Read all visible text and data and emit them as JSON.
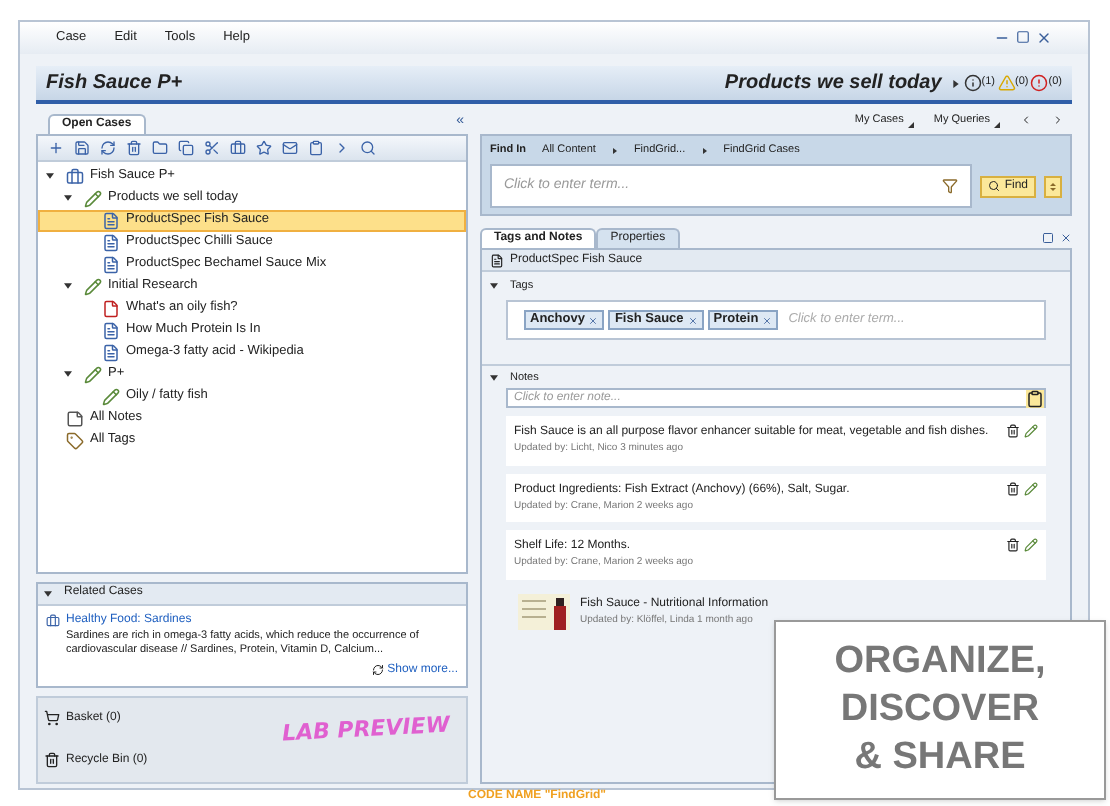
{
  "menu": [
    "Case",
    "Edit",
    "Tools",
    "Help"
  ],
  "title": "Fish Sauce P+",
  "context_title": "Products we sell today",
  "status_counts": [
    {
      "kind": "info",
      "count": "(1)"
    },
    {
      "kind": "warning",
      "count": "(0)"
    },
    {
      "kind": "error",
      "count": "(0)"
    }
  ],
  "left_tab": "Open Cases",
  "collapse_glyph": "«",
  "tree": [
    {
      "label": "Fish Sauce P+",
      "kind": "case",
      "expanded": true,
      "selected": false,
      "children": [
        {
          "label": "Products we sell today",
          "kind": "folder",
          "expanded": true,
          "selected": false,
          "children": [
            {
              "label": "ProductSpec Fish Sauce",
              "kind": "doc",
              "selected": true
            },
            {
              "label": "ProductSpec Chilli Sauce",
              "kind": "doc",
              "selected": false
            },
            {
              "label": "ProductSpec Bechamel Sauce Mix",
              "kind": "doc",
              "selected": false
            }
          ]
        },
        {
          "label": "Initial Research",
          "kind": "folder",
          "expanded": true,
          "selected": false,
          "children": [
            {
              "label": "What's an oily fish?",
              "kind": "pdf",
              "selected": false
            },
            {
              "label": "How Much Protein Is In",
              "kind": "doc",
              "selected": false
            },
            {
              "label": "Omega-3 fatty acid - Wikipedia",
              "kind": "doc",
              "selected": false
            }
          ]
        },
        {
          "label": "P+",
          "kind": "folder",
          "expanded": true,
          "selected": false,
          "children": [
            {
              "label": "Oily / fatty fish",
              "kind": "folder",
              "selected": false
            }
          ]
        }
      ]
    },
    {
      "label": "All Notes",
      "kind": "note",
      "selected": false
    },
    {
      "label": "All Tags",
      "kind": "tag",
      "selected": false
    }
  ],
  "related_cases": {
    "title": "Related Cases",
    "expanded": true,
    "link": "Healthy Food: Sardines",
    "text": "Sardines are rich in omega-3 fatty acids, which reduce the occurrence of cardiovascular disease // Sardines, Protein, Vitamin D, Calcium...",
    "more": "Show more..."
  },
  "bins": [
    {
      "kind": "basket",
      "label": "Basket (0)"
    },
    {
      "kind": "trash",
      "label": "Recycle Bin (0)"
    }
  ],
  "lab_preview": "LAB PREVIEW",
  "top_links": [
    "My Cases",
    "My Queries"
  ],
  "find": {
    "label": "Find In",
    "path": [
      "All Content",
      "FindGrid...",
      "FindGrid Cases"
    ],
    "placeholder": "Click to enter term...",
    "button": "Find"
  },
  "detail_tabs": [
    {
      "label": "Tags and Notes",
      "selected": true
    },
    {
      "label": "Properties",
      "selected": false
    }
  ],
  "document": "ProductSpec Fish Sauce",
  "tags": {
    "title": "Tags",
    "expanded": true,
    "items": [
      "Anchovy",
      "Fish Sauce",
      "Protein"
    ],
    "placeholder": "Click to enter term..."
  },
  "notes": {
    "title": "Notes",
    "expanded": true,
    "placeholder": "Click to enter note...",
    "items": [
      {
        "kind": "note",
        "text": "Fish Sauce is an all purpose flavor enhancer suitable for meat, vegetable and fish dishes.",
        "meta": "Updated by: Licht, Nico 3 minutes ago"
      },
      {
        "kind": "note",
        "text": "Product Ingredients: Fish Extract (Anchovy) (66%), Salt, Sugar.",
        "meta": "Updated by: Crane, Marion 2 weeks ago"
      },
      {
        "kind": "note",
        "text": "Shelf Life: 12 Months.",
        "meta": "Updated by: Crane, Marion 2 weeks ago"
      },
      {
        "kind": "document",
        "text": "Fish Sauce - Nutritional Information",
        "meta": "Updated by: Klöffel, Linda 1 month ago"
      }
    ]
  },
  "code_name": "CODE NAME \"FindGrid\"",
  "callout": [
    "ORGANIZE,",
    "DISCOVER",
    "& SHARE"
  ]
}
